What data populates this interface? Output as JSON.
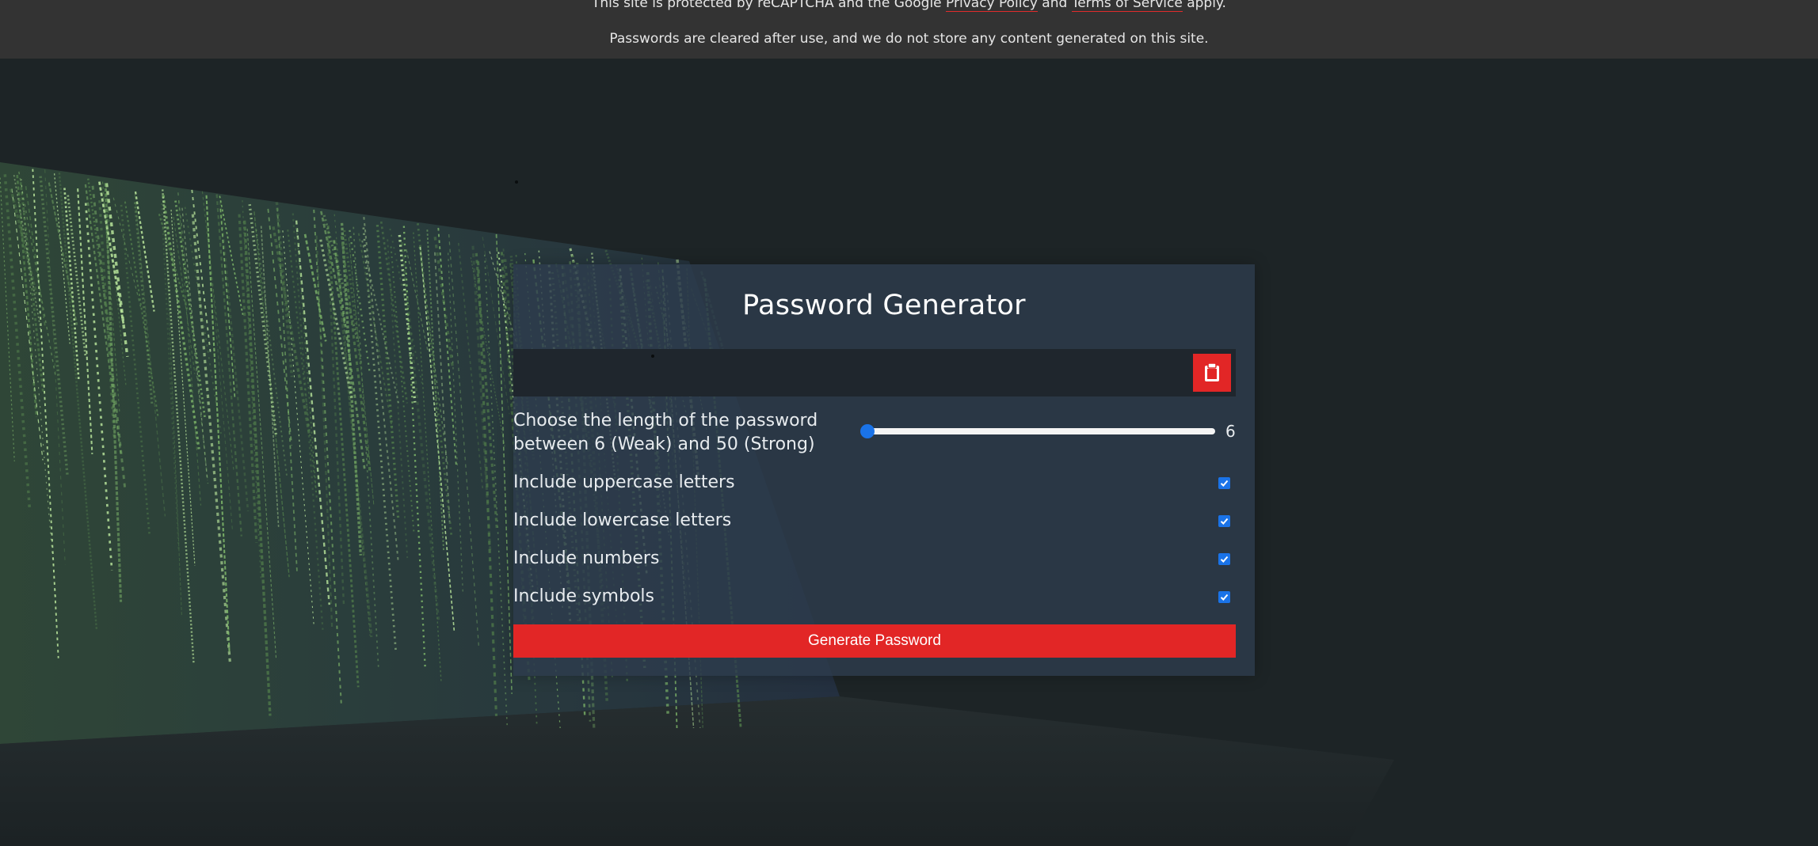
{
  "notice": {
    "line1_prefix": "This site is protected by reCAPTCHA and the Google ",
    "privacy_link": "Privacy Policy",
    "line1_and": " and ",
    "terms_link": "Terms of Service",
    "line1_suffix": " apply.",
    "line2": "Passwords are cleared after use, and we do not store any content generated on this site."
  },
  "generator": {
    "title": "Password Generator",
    "password_value": "",
    "copy_icon": "clipboard-icon",
    "length_label_line1": "Choose the length of the password",
    "length_label_line2": "between 6 (Weak) and 50 (Strong)",
    "length_min": 6,
    "length_max": 50,
    "length_value": "6",
    "options": [
      {
        "label": "Include uppercase letters",
        "checked": true
      },
      {
        "label": "Include lowercase letters",
        "checked": true
      },
      {
        "label": "Include numbers",
        "checked": true
      },
      {
        "label": "Include symbols",
        "checked": true
      }
    ],
    "generate_label": "Generate Password"
  },
  "colors": {
    "accent_red": "#e22626",
    "slider_blue": "#1a73e8",
    "card_bg": "#2d3c4d",
    "notice_bg": "#333333",
    "page_bg": "#1d2426"
  }
}
